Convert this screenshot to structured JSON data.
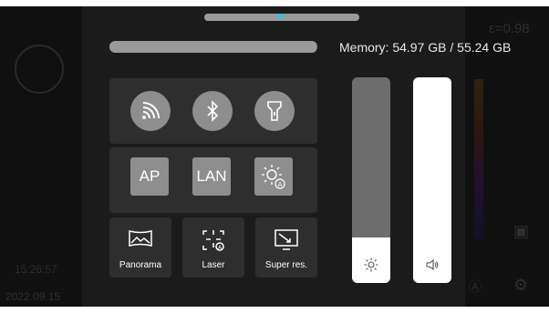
{
  "memory": {
    "text": "Memory: 54.97 GB / 55.24 GB",
    "used_fraction": 0.995
  },
  "quick_toggles": [
    {
      "name": "wifi-hotspot",
      "icon": "wifi-icon"
    },
    {
      "name": "bluetooth",
      "icon": "bluetooth-icon"
    },
    {
      "name": "flashlight",
      "icon": "flashlight-icon"
    }
  ],
  "network_buttons": {
    "ap": "AP",
    "lan": "LAN",
    "auto_brightness_icon": "auto-brightness-icon"
  },
  "modes": {
    "panorama": "Panorama",
    "laser": "Laser",
    "super_res": "Super res."
  },
  "sliders": {
    "brightness_level": 0.22,
    "volume_level": 1.0
  },
  "background": {
    "emissivity": "ε=0.98",
    "time": "15:26:57",
    "date": "2022.09.15"
  },
  "colors": {
    "accent": "#25c4e8",
    "panel": "#2e2e2e",
    "button": "#8e8e8e"
  }
}
